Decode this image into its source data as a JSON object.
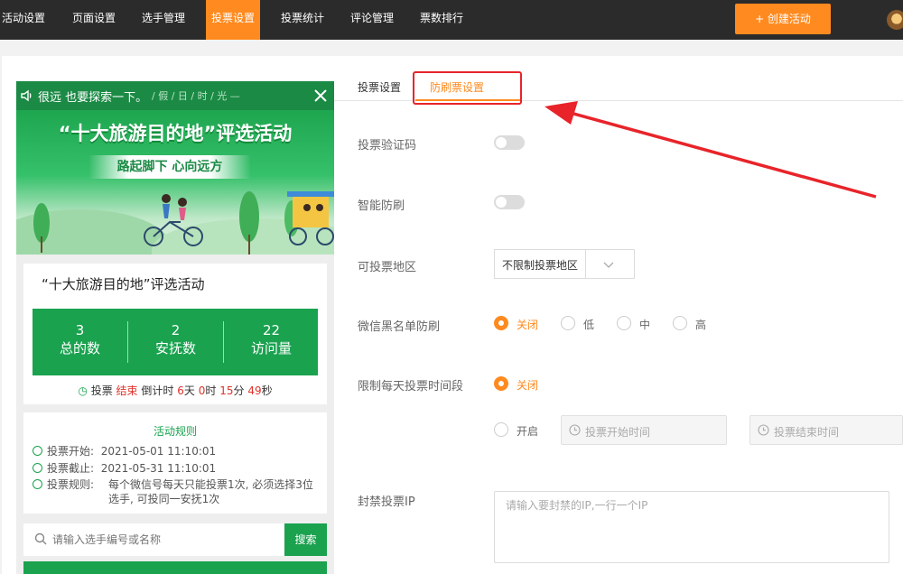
{
  "nav": {
    "items": [
      "活动设置",
      "页面设置",
      "选手管理",
      "投票设置",
      "投票统计",
      "评论管理",
      "票数排行"
    ],
    "active_index": 3,
    "create_button": "+ 创建活动"
  },
  "phone": {
    "bar_text": "很远 也要探索一下。",
    "bar_sub": "/ 假 / 日 / 时 / 光 —",
    "banner_title": "“十大旅游目的地”评选活动",
    "banner_subtitle": "路起脚下 心向远方",
    "event_title": "“十大旅游目的地”评选活动",
    "stats": [
      {
        "value": "3",
        "label": "总的数"
      },
      {
        "value": "2",
        "label": "安抚数"
      },
      {
        "value": "22",
        "label": "访问量"
      }
    ],
    "countdown": {
      "prefix": "投票",
      "status": "结束",
      "label": "倒计时",
      "days": "6",
      "days_unit": "天",
      "hours": "0",
      "hours_unit": "时",
      "minutes": "15",
      "minutes_unit": "分",
      "seconds": "49",
      "seconds_unit": "秒"
    },
    "rules": {
      "title": "活动规则",
      "start_label": "投票开始:",
      "start_value": "2021-05-01 11:10:01",
      "end_label": "投票截止:",
      "end_value": "2021-05-31 11:10:01",
      "rule_label": "投票规则:",
      "rule_value": "每个微信号每天只能投票1次, 必须选择3位选手, 可投同一安抚1次"
    },
    "search": {
      "placeholder": "请输入选手编号或名称",
      "button": "搜索"
    }
  },
  "settings": {
    "tabs": [
      "投票设置",
      "防刷票设置"
    ],
    "active_tab": 1,
    "captcha_label": "投票验证码",
    "captcha_on": false,
    "smart_label": "智能防刷",
    "smart_on": false,
    "region_label": "可投票地区",
    "region_value": "不限制投票地区",
    "blacklist_label": "微信黑名单防刷",
    "blacklist_options": [
      "关闭",
      "低",
      "中",
      "高"
    ],
    "blacklist_selected": "关闭",
    "timespan_label": "限制每天投票时间段",
    "timespan_options": [
      "关闭",
      "开启"
    ],
    "timespan_selected": "关闭",
    "start_time_placeholder": "投票开始时间",
    "end_time_placeholder": "投票结束时间",
    "ip_label": "封禁投票IP",
    "ip_placeholder": "请输入要封禁的IP,一行一个IP"
  },
  "colors": {
    "accent": "#ff8a1f",
    "nav_bg": "#2b2b2b",
    "phone_green": "#1aa24f",
    "annotation_red": "#e8242a"
  }
}
